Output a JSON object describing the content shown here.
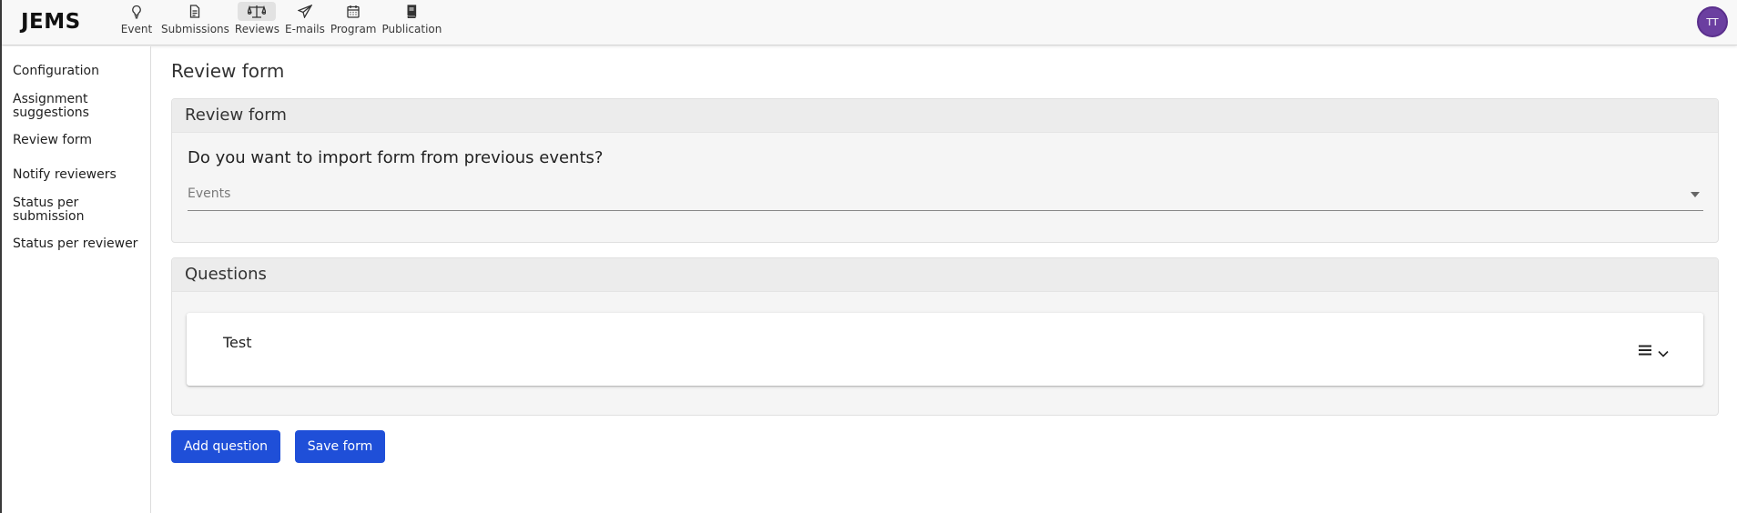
{
  "app": {
    "logo": "JEMS"
  },
  "nav": [
    {
      "label": "Event",
      "icon": "lightbulb-icon",
      "active": false
    },
    {
      "label": "Submissions",
      "icon": "document-icon",
      "active": false
    },
    {
      "label": "Reviews",
      "icon": "scale-icon",
      "active": true
    },
    {
      "label": "E-mails",
      "icon": "paper-plane-icon",
      "active": false
    },
    {
      "label": "Program",
      "icon": "calendar-icon",
      "active": false
    },
    {
      "label": "Publication",
      "icon": "book-icon",
      "active": false
    }
  ],
  "user": {
    "initials": "TT",
    "avatar_color": "#6b3fa0"
  },
  "sidebar": {
    "items": [
      {
        "label": "Configuration"
      },
      {
        "label": "Assignment suggestions"
      },
      {
        "label": "Review form"
      },
      {
        "label": "Notify reviewers"
      },
      {
        "label": "Status per submission"
      },
      {
        "label": "Status per reviewer"
      }
    ]
  },
  "main": {
    "title": "Review form",
    "form_card": {
      "header": "Review form",
      "question": "Do you want to import form from previous events?",
      "select_placeholder": "Events"
    },
    "questions_card": {
      "header": "Questions",
      "items": [
        {
          "label": "Test"
        }
      ]
    },
    "buttons": {
      "add_question": "Add question",
      "save_form": "Save form"
    }
  },
  "colors": {
    "primary_button": "#1f4fd8"
  }
}
